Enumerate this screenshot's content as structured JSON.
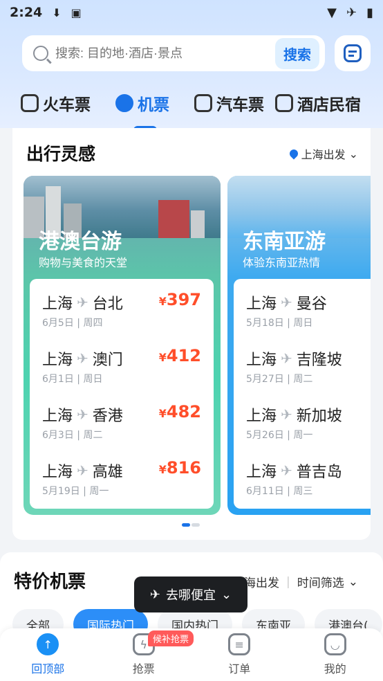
{
  "status": {
    "time": "2:24"
  },
  "search": {
    "placeholder": "搜索: 目的地·酒店·景点",
    "button": "搜索"
  },
  "tabs": [
    {
      "label": "火车票",
      "icon": "train-icon"
    },
    {
      "label": "机票",
      "icon": "plane-icon"
    },
    {
      "label": "汽车票",
      "icon": "bus-icon"
    },
    {
      "label": "酒店民宿",
      "icon": "hotel-icon"
    }
  ],
  "inspiration": {
    "title": "出行灵感",
    "location": "上海出发",
    "destinations": [
      {
        "title": "港澳台游",
        "subtitle": "购物与美食的天堂",
        "routes": [
          {
            "from": "上海",
            "to": "台北",
            "date": "6月5日",
            "weekday": "周四",
            "price": "397"
          },
          {
            "from": "上海",
            "to": "澳门",
            "date": "6月1日",
            "weekday": "周日",
            "price": "412"
          },
          {
            "from": "上海",
            "to": "香港",
            "date": "6月3日",
            "weekday": "周二",
            "price": "482"
          },
          {
            "from": "上海",
            "to": "高雄",
            "date": "5月19日",
            "weekday": "周一",
            "price": "816"
          }
        ]
      },
      {
        "title": "东南亚游",
        "subtitle": "体验东南亚热情",
        "routes": [
          {
            "from": "上海",
            "to": "曼谷",
            "date": "5月18日",
            "weekday": "周日"
          },
          {
            "from": "上海",
            "to": "吉隆坡",
            "date": "5月27日",
            "weekday": "周二"
          },
          {
            "from": "上海",
            "to": "新加坡",
            "date": "5月26日",
            "weekday": "周一"
          },
          {
            "from": "上海",
            "to": "普吉岛",
            "date": "6月11日",
            "weekday": "周三"
          }
        ]
      }
    ]
  },
  "deals": {
    "title": "特价机票",
    "location": "上海出发",
    "filter": "时间筛选",
    "chips": [
      "全部",
      "国际热门",
      "国内热门",
      "东南亚",
      "港澳台("
    ]
  },
  "floating_button": {
    "label": "去哪便宜"
  },
  "nav": {
    "items": [
      "回顶部",
      "抢票",
      "订单",
      "我的"
    ],
    "badge": "候补抢票"
  }
}
